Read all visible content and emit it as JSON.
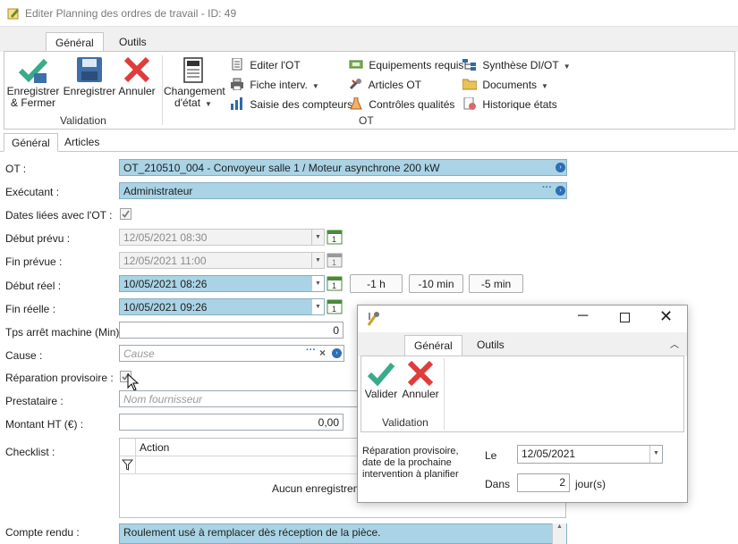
{
  "window": {
    "title": "Editer Planning des ordres de travail - ID: 49"
  },
  "ribbon": {
    "tabs": [
      "Général",
      "Outils"
    ],
    "validation": {
      "save_close": "Enregistrer & Fermer",
      "save": "Enregistrer",
      "cancel": "Annuler",
      "group": "Validation"
    },
    "ot": {
      "change_state": "Changement d'état",
      "edit_ot": "Editer l'OT",
      "fiche_interv": "Fiche interv.",
      "saisie_compteurs": "Saisie des compteurs",
      "equipements": "Equipements requis",
      "articles_ot": "Articles OT",
      "controles": "Contrôles qualités",
      "synthese": "Synthèse DI/OT",
      "documents": "Documents",
      "historique": "Historique états",
      "group": "OT"
    }
  },
  "form_tabs": [
    "Général",
    "Articles"
  ],
  "form": {
    "ot_label": "OT :",
    "ot_value": "OT_210510_004 - Convoyeur salle 1 / Moteur asynchrone 200 kW",
    "executant_label": "Exécutant :",
    "executant_value": "Administrateur",
    "dates_liees_label": "Dates liées avec l'OT :",
    "debut_prevu_label": "Début prévu :",
    "debut_prevu_value": "12/05/2021 08:30",
    "fin_prevue_label": "Fin prévue :",
    "fin_prevue_value": "12/05/2021 11:00",
    "debut_reel_label": "Début réel :",
    "debut_reel_value": "10/05/2021 08:26",
    "fin_reelle_label": "Fin réelle :",
    "fin_reelle_value": "10/05/2021 09:26",
    "btn_1h": "-1 h",
    "btn_10min": "-10 min",
    "btn_5min": "-5 min",
    "tps_arret_label": "Tps arrêt machine (Min) :",
    "tps_arret_value": "0",
    "cause_label": "Cause :",
    "cause_placeholder": "Cause",
    "reparation_label": "Réparation provisoire :",
    "prestataire_label": "Prestataire :",
    "prestataire_placeholder": "Nom fournisseur",
    "montant_label": "Montant HT (€) :",
    "montant_value": "0,00",
    "checklist_label": "Checklist :",
    "checklist_col_action": "Action",
    "checklist_empty": "Aucun enregistreme",
    "compte_rendu_label": "Compte rendu :",
    "compte_rendu_value": "Roulement usé à remplacer dès réception de la pièce."
  },
  "dialog": {
    "tabs": [
      "Général",
      "Outils"
    ],
    "validate": "Valider",
    "cancel": "Annuler",
    "group": "Validation",
    "description": "Réparation provisoire, date de la prochaine intervention à planifier",
    "le_label": "Le",
    "le_value": "12/05/2021",
    "dans_label": "Dans",
    "dans_value": "2",
    "jours_label": "jour(s)"
  },
  "colors": {
    "field_blue": "#aad4e6",
    "check_green": "#3aaa8a",
    "cancel_red": "#e03c3c",
    "save_blue": "#3d6fa8"
  }
}
